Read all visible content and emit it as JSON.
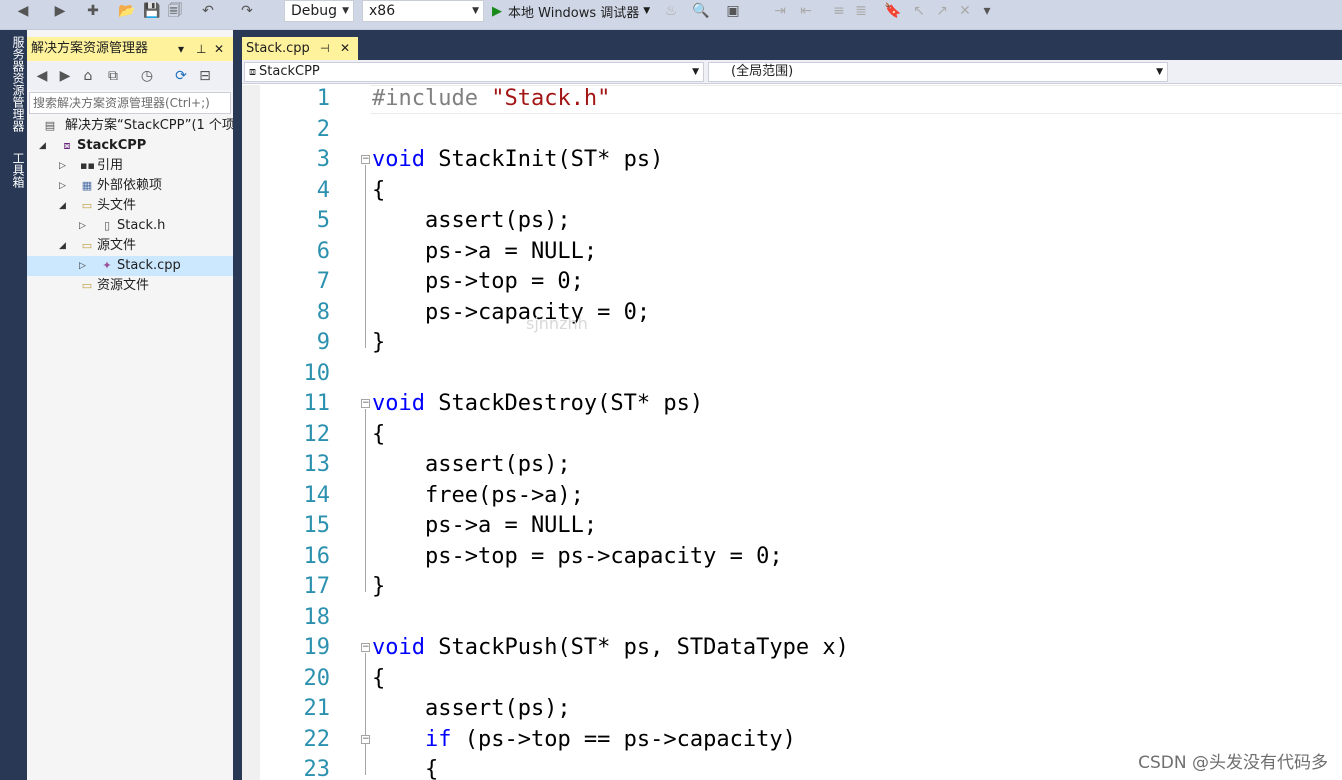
{
  "toolbar": {
    "config": "Debug",
    "platform": "x86",
    "run_label": "本地 Windows 调试器"
  },
  "left_strip": {
    "server_explorer": "服务器资源管理器",
    "toolbox": "工具箱"
  },
  "solution_explorer": {
    "title": "解决方案资源管理器",
    "search_placeholder": "搜索解决方案资源管理器(Ctrl+;)",
    "tree": [
      {
        "label": "解决方案“StackCPP”(1 个项目",
        "depth": 0,
        "expander": "",
        "icon": "solution-icon"
      },
      {
        "label": "StackCPP",
        "depth": 1,
        "expander": "◢",
        "icon": "project-icon",
        "bold": true
      },
      {
        "label": "引用",
        "depth": 2,
        "expander": "▷",
        "icon": "references-icon"
      },
      {
        "label": "外部依赖项",
        "depth": 2,
        "expander": "▷",
        "icon": "external-deps-icon"
      },
      {
        "label": "头文件",
        "depth": 2,
        "expander": "◢",
        "icon": "folder-icon"
      },
      {
        "label": "Stack.h",
        "depth": 3,
        "expander": "▷",
        "icon": "header-file-icon"
      },
      {
        "label": "源文件",
        "depth": 2,
        "expander": "◢",
        "icon": "folder-icon"
      },
      {
        "label": "Stack.cpp",
        "depth": 3,
        "expander": "▷",
        "icon": "cpp-file-icon",
        "selected": true
      },
      {
        "label": "资源文件",
        "depth": 2,
        "expander": "",
        "icon": "folder-icon"
      }
    ]
  },
  "tabs": [
    {
      "label": "Stack.cpp"
    }
  ],
  "navbar": {
    "project": "StackCPP",
    "scope": "(全局范围)"
  },
  "code": [
    [
      {
        "t": "#include ",
        "c": "pp"
      },
      {
        "t": "\"Stack.h\"",
        "c": "st"
      }
    ],
    [],
    [
      {
        "t": "void",
        "c": "kw"
      },
      {
        "t": " StackInit(ST* ps)"
      }
    ],
    [
      {
        "t": "{"
      }
    ],
    [
      {
        "t": "    assert(ps);"
      }
    ],
    [
      {
        "t": "    ps->a = NULL;"
      }
    ],
    [
      {
        "t": "    ps->top = 0;"
      }
    ],
    [
      {
        "t": "    ps->capacity = 0;"
      }
    ],
    [
      {
        "t": "}"
      }
    ],
    [],
    [
      {
        "t": "void",
        "c": "kw"
      },
      {
        "t": " StackDestroy(ST* ps)"
      }
    ],
    [
      {
        "t": "{"
      }
    ],
    [
      {
        "t": "    assert(ps);"
      }
    ],
    [
      {
        "t": "    free(ps->a);"
      }
    ],
    [
      {
        "t": "    ps->a = NULL;"
      }
    ],
    [
      {
        "t": "    ps->top = ps->capacity = 0;"
      }
    ],
    [
      {
        "t": "}"
      }
    ],
    [],
    [
      {
        "t": "void",
        "c": "kw"
      },
      {
        "t": " StackPush(ST* ps, STDataType x)"
      }
    ],
    [
      {
        "t": "{"
      }
    ],
    [
      {
        "t": "    assert(ps);"
      }
    ],
    [
      {
        "t": "    "
      },
      {
        "t": "if",
        "c": "kw"
      },
      {
        "t": " (ps->top == ps->capacity)"
      }
    ],
    [
      {
        "t": "    {"
      }
    ]
  ],
  "watermark": "sjnnzhh",
  "footer_watermark": "CSDN @头发没有代码多"
}
